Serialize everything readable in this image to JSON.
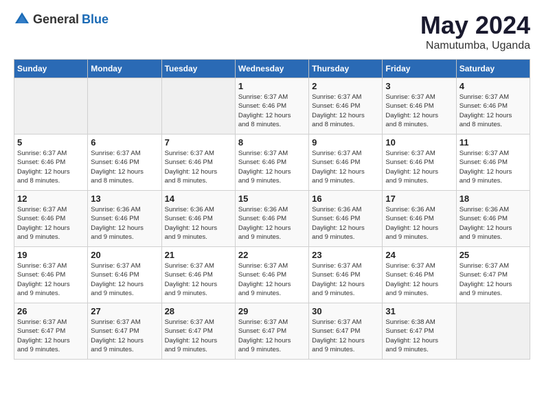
{
  "logo": {
    "text_general": "General",
    "text_blue": "Blue"
  },
  "title": {
    "month": "May 2024",
    "location": "Namutumba, Uganda"
  },
  "days_of_week": [
    "Sunday",
    "Monday",
    "Tuesday",
    "Wednesday",
    "Thursday",
    "Friday",
    "Saturday"
  ],
  "weeks": [
    [
      {
        "day": "",
        "info": ""
      },
      {
        "day": "",
        "info": ""
      },
      {
        "day": "",
        "info": ""
      },
      {
        "day": "1",
        "info": "Sunrise: 6:37 AM\nSunset: 6:46 PM\nDaylight: 12 hours\nand 8 minutes."
      },
      {
        "day": "2",
        "info": "Sunrise: 6:37 AM\nSunset: 6:46 PM\nDaylight: 12 hours\nand 8 minutes."
      },
      {
        "day": "3",
        "info": "Sunrise: 6:37 AM\nSunset: 6:46 PM\nDaylight: 12 hours\nand 8 minutes."
      },
      {
        "day": "4",
        "info": "Sunrise: 6:37 AM\nSunset: 6:46 PM\nDaylight: 12 hours\nand 8 minutes."
      }
    ],
    [
      {
        "day": "5",
        "info": "Sunrise: 6:37 AM\nSunset: 6:46 PM\nDaylight: 12 hours\nand 8 minutes."
      },
      {
        "day": "6",
        "info": "Sunrise: 6:37 AM\nSunset: 6:46 PM\nDaylight: 12 hours\nand 8 minutes."
      },
      {
        "day": "7",
        "info": "Sunrise: 6:37 AM\nSunset: 6:46 PM\nDaylight: 12 hours\nand 8 minutes."
      },
      {
        "day": "8",
        "info": "Sunrise: 6:37 AM\nSunset: 6:46 PM\nDaylight: 12 hours\nand 9 minutes."
      },
      {
        "day": "9",
        "info": "Sunrise: 6:37 AM\nSunset: 6:46 PM\nDaylight: 12 hours\nand 9 minutes."
      },
      {
        "day": "10",
        "info": "Sunrise: 6:37 AM\nSunset: 6:46 PM\nDaylight: 12 hours\nand 9 minutes."
      },
      {
        "day": "11",
        "info": "Sunrise: 6:37 AM\nSunset: 6:46 PM\nDaylight: 12 hours\nand 9 minutes."
      }
    ],
    [
      {
        "day": "12",
        "info": "Sunrise: 6:37 AM\nSunset: 6:46 PM\nDaylight: 12 hours\nand 9 minutes."
      },
      {
        "day": "13",
        "info": "Sunrise: 6:36 AM\nSunset: 6:46 PM\nDaylight: 12 hours\nand 9 minutes."
      },
      {
        "day": "14",
        "info": "Sunrise: 6:36 AM\nSunset: 6:46 PM\nDaylight: 12 hours\nand 9 minutes."
      },
      {
        "day": "15",
        "info": "Sunrise: 6:36 AM\nSunset: 6:46 PM\nDaylight: 12 hours\nand 9 minutes."
      },
      {
        "day": "16",
        "info": "Sunrise: 6:36 AM\nSunset: 6:46 PM\nDaylight: 12 hours\nand 9 minutes."
      },
      {
        "day": "17",
        "info": "Sunrise: 6:36 AM\nSunset: 6:46 PM\nDaylight: 12 hours\nand 9 minutes."
      },
      {
        "day": "18",
        "info": "Sunrise: 6:36 AM\nSunset: 6:46 PM\nDaylight: 12 hours\nand 9 minutes."
      }
    ],
    [
      {
        "day": "19",
        "info": "Sunrise: 6:37 AM\nSunset: 6:46 PM\nDaylight: 12 hours\nand 9 minutes."
      },
      {
        "day": "20",
        "info": "Sunrise: 6:37 AM\nSunset: 6:46 PM\nDaylight: 12 hours\nand 9 minutes."
      },
      {
        "day": "21",
        "info": "Sunrise: 6:37 AM\nSunset: 6:46 PM\nDaylight: 12 hours\nand 9 minutes."
      },
      {
        "day": "22",
        "info": "Sunrise: 6:37 AM\nSunset: 6:46 PM\nDaylight: 12 hours\nand 9 minutes."
      },
      {
        "day": "23",
        "info": "Sunrise: 6:37 AM\nSunset: 6:46 PM\nDaylight: 12 hours\nand 9 minutes."
      },
      {
        "day": "24",
        "info": "Sunrise: 6:37 AM\nSunset: 6:46 PM\nDaylight: 12 hours\nand 9 minutes."
      },
      {
        "day": "25",
        "info": "Sunrise: 6:37 AM\nSunset: 6:47 PM\nDaylight: 12 hours\nand 9 minutes."
      }
    ],
    [
      {
        "day": "26",
        "info": "Sunrise: 6:37 AM\nSunset: 6:47 PM\nDaylight: 12 hours\nand 9 minutes."
      },
      {
        "day": "27",
        "info": "Sunrise: 6:37 AM\nSunset: 6:47 PM\nDaylight: 12 hours\nand 9 minutes."
      },
      {
        "day": "28",
        "info": "Sunrise: 6:37 AM\nSunset: 6:47 PM\nDaylight: 12 hours\nand 9 minutes."
      },
      {
        "day": "29",
        "info": "Sunrise: 6:37 AM\nSunset: 6:47 PM\nDaylight: 12 hours\nand 9 minutes."
      },
      {
        "day": "30",
        "info": "Sunrise: 6:37 AM\nSunset: 6:47 PM\nDaylight: 12 hours\nand 9 minutes."
      },
      {
        "day": "31",
        "info": "Sunrise: 6:38 AM\nSunset: 6:47 PM\nDaylight: 12 hours\nand 9 minutes."
      },
      {
        "day": "",
        "info": ""
      }
    ]
  ]
}
